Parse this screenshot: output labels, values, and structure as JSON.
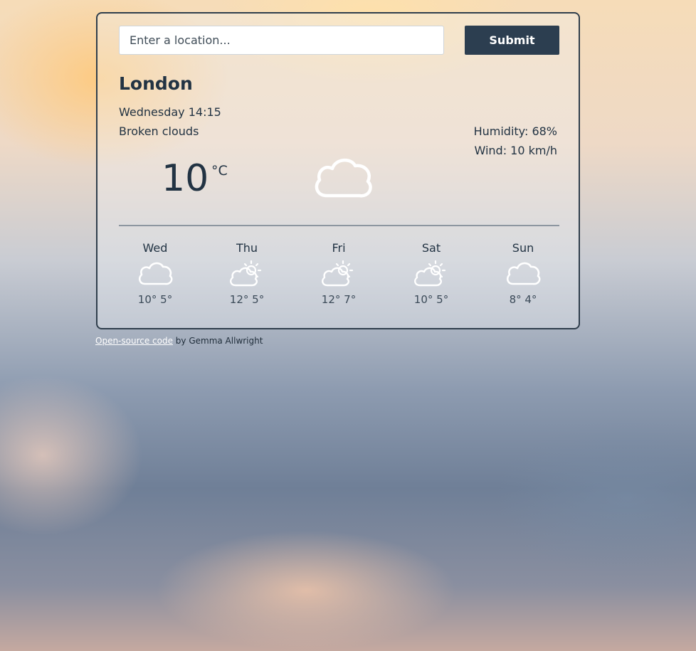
{
  "search": {
    "placeholder": "Enter a location...",
    "value": ""
  },
  "submit_label": "Submit",
  "current": {
    "city": "London",
    "datetime": "Wednesday 14:15",
    "description": "Broken clouds",
    "humidity": "Humidity: 68%",
    "wind": "Wind: 10 km/h",
    "temperature": "10",
    "unit": "°C",
    "icon": "cloud-icon"
  },
  "forecast": [
    {
      "day": "Wed",
      "temps": "10° 5°",
      "icon": "cloud-icon"
    },
    {
      "day": "Thu",
      "temps": "12° 5°",
      "icon": "partly-sunny-icon"
    },
    {
      "day": "Fri",
      "temps": "12° 7°",
      "icon": "partly-sunny-icon"
    },
    {
      "day": "Sat",
      "temps": "10° 5°",
      "icon": "partly-sunny-icon"
    },
    {
      "day": "Sun",
      "temps": "8° 4°",
      "icon": "cloud-icon"
    }
  ],
  "footer": {
    "link_text": "Open-source code",
    "author_text": " by Gemma Allwright"
  },
  "colors": {
    "accent": "#2c3e50",
    "text": "#223343"
  }
}
